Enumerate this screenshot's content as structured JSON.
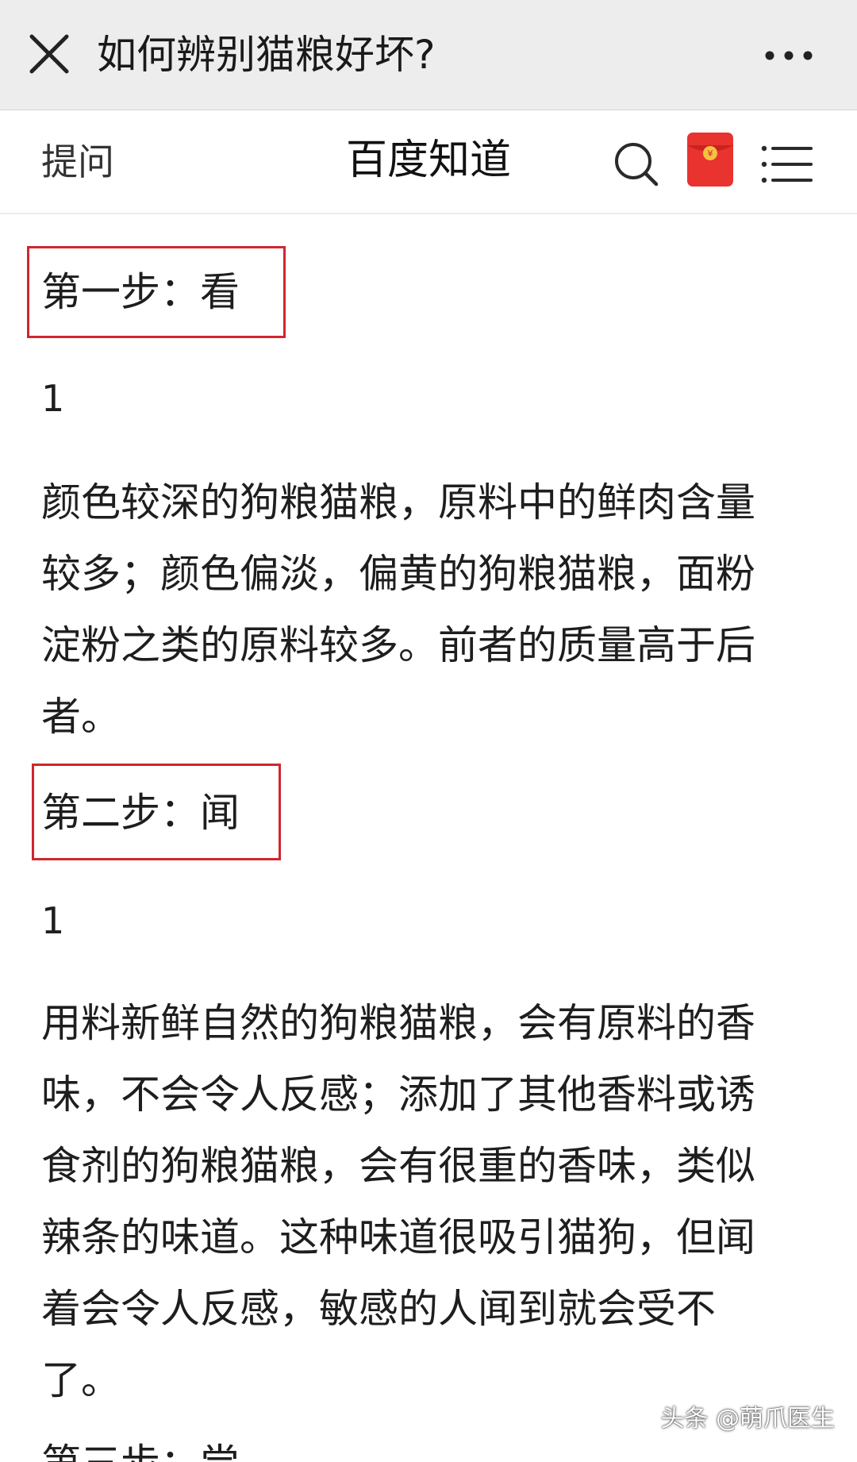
{
  "titlebar": {
    "close_icon": "close-icon",
    "title": "如何辨别猫粮好坏?",
    "more_icon": "more-dots-icon"
  },
  "header": {
    "ask_label": "提问",
    "brand": "百度知道",
    "search_icon": "search-icon",
    "redpacket_icon": "red-envelope-icon",
    "menu_icon": "menu-list-icon"
  },
  "article": {
    "steps": [
      {
        "heading": "第一步：看",
        "number": "1",
        "lines": [
          "颜色较深的狗粮猫粮，原料中的鲜肉含量",
          "较多；颜色偏淡，偏黄的狗粮猫粮，面粉",
          "淀粉之类的原料较多。前者的质量高于后",
          "者。"
        ]
      },
      {
        "heading": "第二步：闻",
        "number": "1",
        "lines": [
          "用料新鲜自然的狗粮猫粮，会有原料的香",
          "味，不会令人反感；添加了其他香料或诱",
          "食剂的狗粮猫粮，会有很重的香味，类似",
          "辣条的味道。这种味道很吸引猫狗，但闻",
          "着会令人反感，敏感的人闻到就会受不",
          "了。"
        ]
      },
      {
        "heading": "第三步：尝"
      }
    ]
  },
  "watermark": "头条 @萌爪医生",
  "colors": {
    "titlebar_bg": "#ededed",
    "highlight_box": "#d0262d",
    "red_envelope": "#e8332f",
    "red_envelope_seal": "#f5c242"
  }
}
